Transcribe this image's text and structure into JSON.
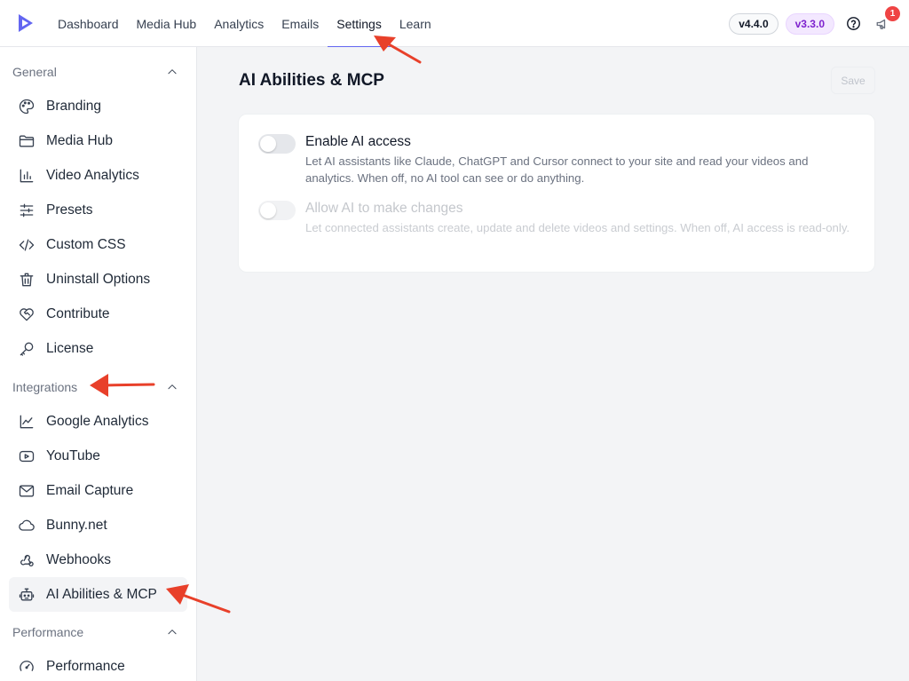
{
  "colors": {
    "accent": "#6366f1",
    "arrow": "#e8402a",
    "notification": "#ef4444",
    "version_purple": "#7e22ce"
  },
  "topnav": {
    "logo_icon": "presto-logo-icon",
    "items": [
      {
        "label": "Dashboard"
      },
      {
        "label": "Media Hub"
      },
      {
        "label": "Analytics"
      },
      {
        "label": "Emails"
      },
      {
        "label": "Settings",
        "active": true
      },
      {
        "label": "Learn"
      }
    ],
    "version_primary": "v4.4.0",
    "version_secondary": "v3.3.0",
    "help_icon": "help-circle-icon",
    "notifications_icon": "megaphone-icon",
    "notifications_count": "1"
  },
  "sidebar": {
    "sections": [
      {
        "title": "General",
        "items": [
          {
            "label": "Branding",
            "icon": "palette-icon"
          },
          {
            "label": "Media Hub",
            "icon": "folder-icon"
          },
          {
            "label": "Video Analytics",
            "icon": "bar-chart-icon"
          },
          {
            "label": "Presets",
            "icon": "sliders-icon"
          },
          {
            "label": "Custom CSS",
            "icon": "code-icon"
          },
          {
            "label": "Uninstall Options",
            "icon": "trash-icon"
          },
          {
            "label": "Contribute",
            "icon": "heart-handshake-icon"
          },
          {
            "label": "License",
            "icon": "key-icon"
          }
        ]
      },
      {
        "title": "Integrations",
        "items": [
          {
            "label": "Google Analytics",
            "icon": "line-chart-icon"
          },
          {
            "label": "YouTube",
            "icon": "youtube-icon"
          },
          {
            "label": "Email Capture",
            "icon": "mail-icon"
          },
          {
            "label": "Bunny.net",
            "icon": "cloud-icon"
          },
          {
            "label": "Webhooks",
            "icon": "webhook-icon"
          },
          {
            "label": "AI Abilities & MCP",
            "icon": "robot-icon",
            "active": true
          }
        ]
      },
      {
        "title": "Performance",
        "items": [
          {
            "label": "Performance",
            "icon": "gauge-icon"
          }
        ]
      }
    ]
  },
  "main": {
    "title": "AI Abilities & MCP",
    "save_label": "Save",
    "options": [
      {
        "title": "Enable AI access",
        "description": "Let AI assistants like Claude, ChatGPT and Cursor connect to your site and read your videos and analytics. When off, no AI tool can see or do anything.",
        "enabled": false,
        "disabled": false
      },
      {
        "title": "Allow AI to make changes",
        "description": "Let connected assistants create, update and delete videos and settings. When off, AI access is read-only.",
        "enabled": false,
        "disabled": true
      }
    ]
  }
}
